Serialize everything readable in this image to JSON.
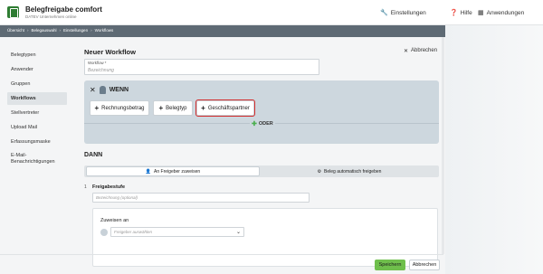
{
  "header": {
    "app_title": "Belegfreigabe comfort",
    "app_subtitle": "DATEV Unternehmen online",
    "settings": "Einstellungen",
    "help": "Hilfe",
    "apps": "Anwendungen"
  },
  "breadcrumb": [
    "Übersicht",
    "Belegauswahl",
    "Einstellungen",
    "Workflows"
  ],
  "sidebar": {
    "items": [
      {
        "label": "Belegtypen"
      },
      {
        "label": "Anwender"
      },
      {
        "label": "Gruppen"
      },
      {
        "label": "Workflows"
      },
      {
        "label": "Stellvertreter"
      },
      {
        "label": "Upload Mail"
      },
      {
        "label": "Erfassungsmaske"
      },
      {
        "label": "E-Mail-Benachrichtigungen"
      }
    ]
  },
  "main": {
    "title": "Neuer Workflow",
    "cancel_top": "Abbrechen",
    "workflow_label": "Workflow *",
    "workflow_placeholder": "Bezeichnung",
    "wenn": {
      "label": "WENN",
      "conditions": [
        "Rechnungsbetrag",
        "Belegtyp",
        "Geschäftspartner"
      ],
      "oder": "ODER"
    },
    "dann": {
      "label": "DANN",
      "tabs": [
        "An Freigeber zuweisen",
        "Beleg automatisch freigeben"
      ],
      "step_number": "1",
      "step_title": "Freigabestufe",
      "step_placeholder": "Bezeichnung (optional)",
      "assign_label": "Zuweisen an",
      "select_placeholder": "Freigeber auswählen"
    }
  },
  "footer": {
    "save": "Speichern",
    "cancel": "Abbrechen"
  }
}
